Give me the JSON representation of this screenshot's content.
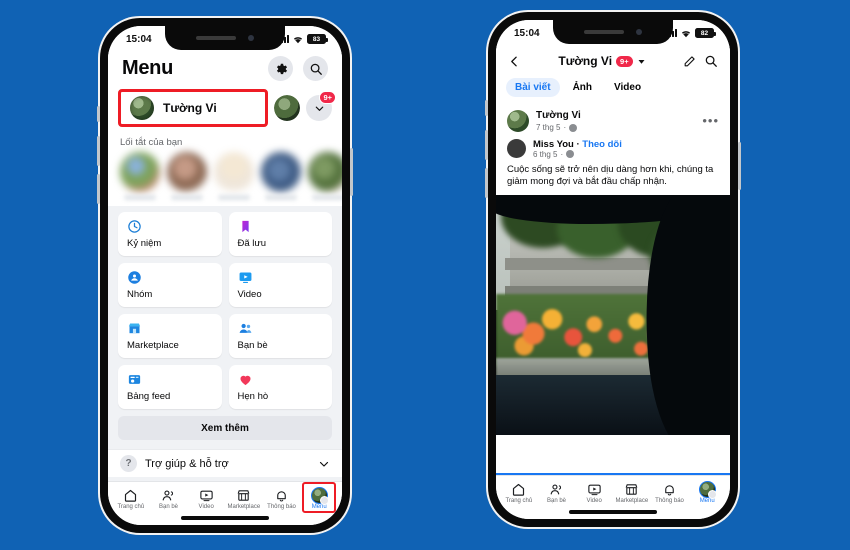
{
  "background_color": "#1062b4",
  "highlight_color": "#ee1c25",
  "accent_color": "#1877f2",
  "left_phone": {
    "status_bar": {
      "time": "15:04",
      "battery": "83",
      "wifi_icon": "wifi-icon",
      "signal_icon": "signal-icon"
    },
    "header": {
      "title": "Menu",
      "settings_icon": "gear-icon",
      "search_icon": "search-icon"
    },
    "profile_row": {
      "name": "Tường Vi",
      "avatar_icon": "user-avatar",
      "switch_account_icon": "switch-account-icon",
      "expand_icon": "chevron-down-icon",
      "notification_badge": "9+",
      "highlighted": true
    },
    "shortcuts": {
      "label": "Lối tắt của bạn",
      "count": 5
    },
    "tiles": [
      {
        "label": "Kỷ niệm",
        "icon": "memories-clock-icon"
      },
      {
        "label": "Đã lưu",
        "icon": "saved-bookmark-icon"
      },
      {
        "label": "Nhóm",
        "icon": "groups-icon"
      },
      {
        "label": "Video",
        "icon": "video-icon"
      },
      {
        "label": "Marketplace",
        "icon": "marketplace-shop-icon"
      },
      {
        "label": "Bạn bè",
        "icon": "friends-icon"
      },
      {
        "label": "Bảng feed",
        "icon": "feeds-icon"
      },
      {
        "label": "Hẹn hò",
        "icon": "dating-heart-icon"
      }
    ],
    "see_more": "Xem thêm",
    "help": {
      "label": "Trợ giúp & hỗ trợ",
      "icon": "question-mark-icon",
      "expand_icon": "chevron-down-icon"
    },
    "bottom_nav": [
      {
        "label": "Trang chủ",
        "icon": "home-icon",
        "active": false,
        "boxed": false
      },
      {
        "label": "Bạn bè",
        "icon": "friends-icon",
        "active": false,
        "boxed": false
      },
      {
        "label": "Video",
        "icon": "video-icon",
        "active": false,
        "boxed": false
      },
      {
        "label": "Marketplace",
        "icon": "marketplace-icon",
        "active": false,
        "boxed": false
      },
      {
        "label": "Thông báo",
        "icon": "bell-icon",
        "active": false,
        "boxed": false
      },
      {
        "label": "Menu",
        "icon": "profile-avatar-icon",
        "active": true,
        "boxed": true
      }
    ]
  },
  "right_phone": {
    "status_bar": {
      "time": "15:04",
      "battery": "82",
      "wifi_icon": "wifi-icon",
      "signal_icon": "signal-icon"
    },
    "header": {
      "back_icon": "chevron-left-icon",
      "title": "Tường Vi",
      "badge": "9+",
      "dropdown_icon": "chevron-down-icon",
      "edit_icon": "pencil-icon",
      "search_icon": "search-icon"
    },
    "tabs": [
      {
        "label": "Bài viết",
        "selected": true
      },
      {
        "label": "Ảnh",
        "selected": false
      },
      {
        "label": "Video",
        "selected": false
      }
    ],
    "post": {
      "author": "Tường Vi",
      "timestamp": "7 thg 5",
      "privacy_icon": "globe-icon",
      "menu_icon": "more-options-icon",
      "shared": {
        "name": "Miss You",
        "separator": "·",
        "follow_label": "Theo dõi",
        "timestamp": "6 thg 5",
        "privacy_icon": "globe-icon"
      },
      "text": "Cuộc sống sẽ trở nên dịu dàng hơn khi, chúng ta giảm mong đợi và bắt đầu chấp nhận.",
      "image_alt": "roadside-flowers-photo"
    },
    "bottom_nav": [
      {
        "label": "Trang chủ",
        "icon": "home-icon",
        "active": false
      },
      {
        "label": "Bạn bè",
        "icon": "friends-icon",
        "active": false
      },
      {
        "label": "Video",
        "icon": "video-icon",
        "active": false
      },
      {
        "label": "Marketplace",
        "icon": "marketplace-icon",
        "active": false
      },
      {
        "label": "Thông báo",
        "icon": "bell-icon",
        "active": false
      },
      {
        "label": "Menu",
        "icon": "profile-avatar-icon",
        "active": true
      }
    ]
  }
}
